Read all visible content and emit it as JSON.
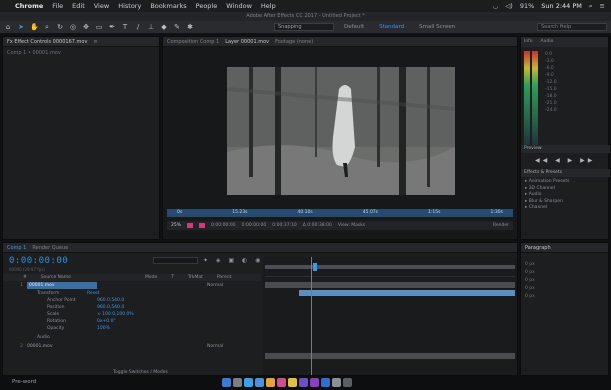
{
  "menubar": {
    "apple": "",
    "app": "Chrome",
    "items": [
      "File",
      "Edit",
      "View",
      "History",
      "Bookmarks",
      "People",
      "Window",
      "Help"
    ],
    "battery": "91%",
    "clock": "Sun 2:44 PM"
  },
  "titlebar": {
    "title": "Adobe After Effects CC 2017 - Untitled Project *"
  },
  "toolbar": {
    "tools": [
      "selection-tool",
      "hand-tool",
      "zoom-tool",
      "rotate-tool",
      "camera-tool",
      "pan-tool",
      "mask-tool",
      "pen-tool",
      "type-tool",
      "brush-tool",
      "clone-tool",
      "eraser-tool",
      "roto-tool",
      "puppet-tool"
    ],
    "snapping": "Snapping",
    "workspaces": [
      {
        "label": "Default",
        "active": false
      },
      {
        "label": "Standard",
        "active": true
      },
      {
        "label": "Small Screen",
        "active": false
      }
    ],
    "search_placeholder": "Search Help"
  },
  "effect_controls": {
    "tabs": [
      {
        "label": "Fx Effect Controls 0000167.mov",
        "active": true
      },
      {
        "label": "≡",
        "active": false
      }
    ],
    "subtitle": "Comp 1 • 00001.mov"
  },
  "viewer": {
    "tabs": [
      "Composition Comp 1",
      "Layer 00001.mov",
      "Footage (none)"
    ],
    "ruler_labels": [
      "0s",
      "15.23s",
      "40.10s",
      "45.07s",
      "1:15s",
      "1:30s"
    ],
    "controls": {
      "zoom": "25%",
      "timecode": "0:00:00:00",
      "range_start": "0:00:00:00",
      "range_end": "0:00:37:10",
      "duration": "Δ 0:00:38:00",
      "view": "View: Masks",
      "render": "Render"
    }
  },
  "right_panels": {
    "tabs": [
      "Info",
      "Audio"
    ],
    "info_lines": [
      "0.0",
      "-3.0",
      "-6.0",
      "-9.0",
      "-12.0",
      "-15.0",
      "-18.0",
      "-21.0",
      "-24.0"
    ],
    "preview_label": "Preview",
    "preview_buttons": "◀◀ ◀ ▶ ▶▶",
    "effects_label": "Effects & Presets",
    "effects_items": [
      "▸ Animation Presets",
      "▸ 3D Channel",
      "▸ Audio",
      "▸ Blur & Sharpen",
      "▸ Channel"
    ]
  },
  "timeline": {
    "tabs": [
      "Comp 1",
      "Render Queue"
    ],
    "time": "0:00:00:00",
    "frames": "00000 (29.97 fps)",
    "column_headers": [
      "#",
      "Source Name",
      "Mode",
      "T",
      "TrkMat",
      "Parent"
    ],
    "layers": [
      {
        "num": "1",
        "name": "00001.mov",
        "selected": true,
        "mode": "Normal"
      },
      {
        "num": "2",
        "name": "00001.mov",
        "selected": false,
        "mode": "Normal"
      }
    ],
    "transform_label": "Transform",
    "reset": "Reset",
    "properties": [
      {
        "name": "Anchor Point",
        "value": "960.0,540.0"
      },
      {
        "name": "Position",
        "value": "960.0,540.0"
      },
      {
        "name": "Scale",
        "value": "∞ 100.0,100.0%"
      },
      {
        "name": "Rotation",
        "value": "0x+0.0°"
      },
      {
        "name": "Opacity",
        "value": "100%"
      }
    ],
    "audio_label": "Audio",
    "bottom_label": "Toggle Switches / Modes"
  },
  "paragraph": {
    "tabs": [
      "Paragraph"
    ],
    "fields": [
      "0 px",
      "0 px",
      "0 px",
      "0 px",
      "0 px"
    ]
  },
  "statusbar": {
    "text": "Pre-word"
  },
  "dock": {
    "icons": [
      "finder-icon",
      "launchpad-icon",
      "safari-icon",
      "mail-icon",
      "photos-icon",
      "itunes-icon",
      "chrome-icon",
      "after-effects-icon",
      "premiere-icon",
      "photoshop-icon",
      "settings-icon",
      "trash-icon"
    ]
  },
  "colors": {
    "accent": "#2f8fe6",
    "meter_top": "#c43333",
    "meter_mid": "#c6b634",
    "meter_bottom": "#2e9e5a"
  }
}
